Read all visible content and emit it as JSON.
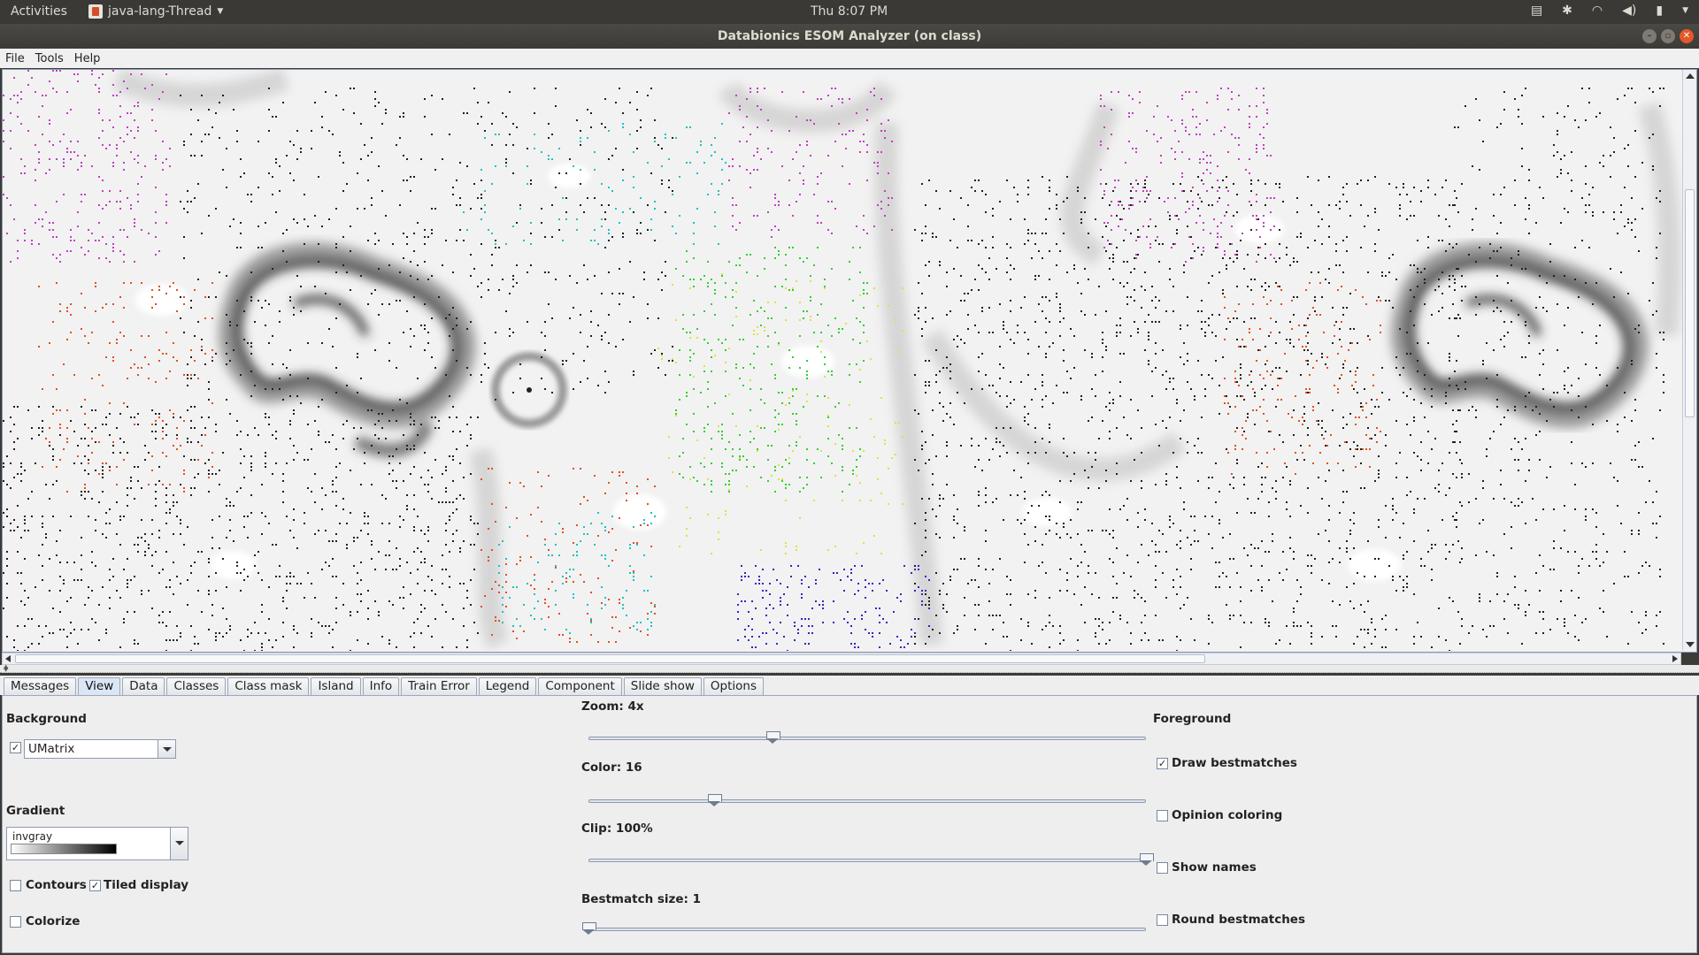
{
  "system_bar": {
    "activities": "Activities",
    "app_name": "java-lang-Thread",
    "clock": "Thu  8:07 PM"
  },
  "window": {
    "title": "Databionics ESOM Analyzer (on class)"
  },
  "menu": {
    "items": [
      "File",
      "Tools",
      "Help"
    ]
  },
  "tabs": [
    "Messages",
    "View",
    "Data",
    "Classes",
    "Class mask",
    "Island",
    "Info",
    "Train Error",
    "Legend",
    "Component",
    "Slide show",
    "Options"
  ],
  "active_tab": "View",
  "view_panel": {
    "background": {
      "heading": "Background",
      "enabled": true,
      "selected": "UMatrix"
    },
    "gradient": {
      "heading": "Gradient",
      "selected": "invgray"
    },
    "contours": {
      "label": "Contours",
      "checked": false
    },
    "tiled_display": {
      "label": "Tiled display",
      "checked": true
    },
    "colorize": {
      "label": "Colorize",
      "checked": false
    },
    "zoom": {
      "label": "Zoom: 4x",
      "fraction": 0.33
    },
    "color": {
      "label": "Color: 16",
      "fraction": 0.225
    },
    "clip": {
      "label": "Clip: 100%",
      "fraction": 1.0
    },
    "bestmatch_size": {
      "label": "Bestmatch size: 1",
      "fraction": 0.0
    },
    "foreground": {
      "heading": "Foreground",
      "draw_bestmatches": {
        "label": "Draw bestmatches",
        "checked": true
      },
      "opinion_coloring": {
        "label": "Opinion coloring",
        "checked": false
      },
      "show_names": {
        "label": "Show names",
        "checked": false
      },
      "round_bestmatches": {
        "label": "Round bestmatches",
        "checked": false
      }
    }
  },
  "map_colors": {
    "background": "#f2f2f2",
    "cluster_colors": [
      "#c040c0",
      "#e05020",
      "#20c0c0",
      "#30d030",
      "#e0e040",
      "#4020c0",
      "#202020"
    ]
  }
}
